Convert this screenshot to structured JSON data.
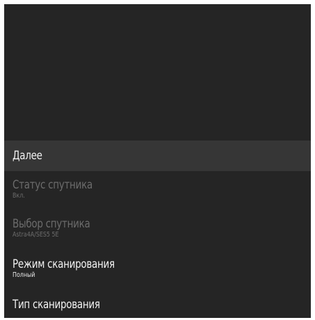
{
  "menu": {
    "items": [
      {
        "label": "Далее",
        "value": "",
        "state": "focused"
      },
      {
        "label": "Статус спутника",
        "value": "Вкл.",
        "state": "disabled"
      },
      {
        "label": "Выбор спутника",
        "value": "Astra4A/SES5 5E",
        "state": "disabled"
      },
      {
        "label": "Режим сканирования",
        "value": "Полный",
        "state": "enabled"
      },
      {
        "label": "Тип сканирования",
        "value": "",
        "state": "enabled"
      }
    ]
  },
  "colors": {
    "panel_background": "#252525",
    "focused_background": "#363636",
    "text_enabled": "#f2f2f2",
    "text_disabled": "#6c6c6c"
  }
}
